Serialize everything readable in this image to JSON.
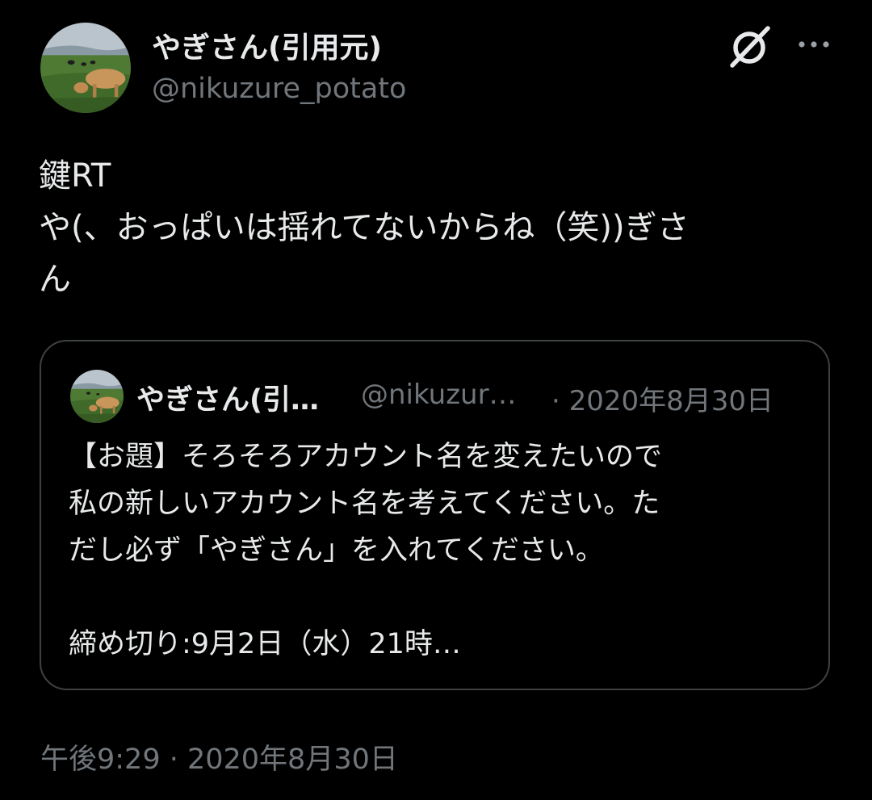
{
  "author": {
    "display_name": "やぎさん(引用元)",
    "handle": "@nikuzure_potato",
    "avatar_icon": "cow-in-pasture-avatar"
  },
  "header_icons": {
    "cast": "no-sign-icon",
    "more": "more-dots-icon"
  },
  "tweet": {
    "lines": [
      "鍵RT",
      "や(、おっぱいは揺れてないからね（笑))ぎさ",
      "ん"
    ],
    "timestamp": "午後9:29 · 2020年8月30日"
  },
  "quoted_tweet": {
    "display_name": "やぎさん(引…",
    "handle": "@nikuzur…",
    "date": "· 2020年8月30日",
    "body_lines": [
      "【お題】そろそろアカウント名を変えたいので",
      "私の新しいアカウント名を考えてください。た",
      "だし必ず「やぎさん」を入れてください。",
      "",
      "締め切り:9月2日（水）21時…"
    ]
  },
  "colors": {
    "background": "#000000",
    "primary_text": "#e7e9ea",
    "secondary_text": "#71767b",
    "border": "#3e4144"
  }
}
